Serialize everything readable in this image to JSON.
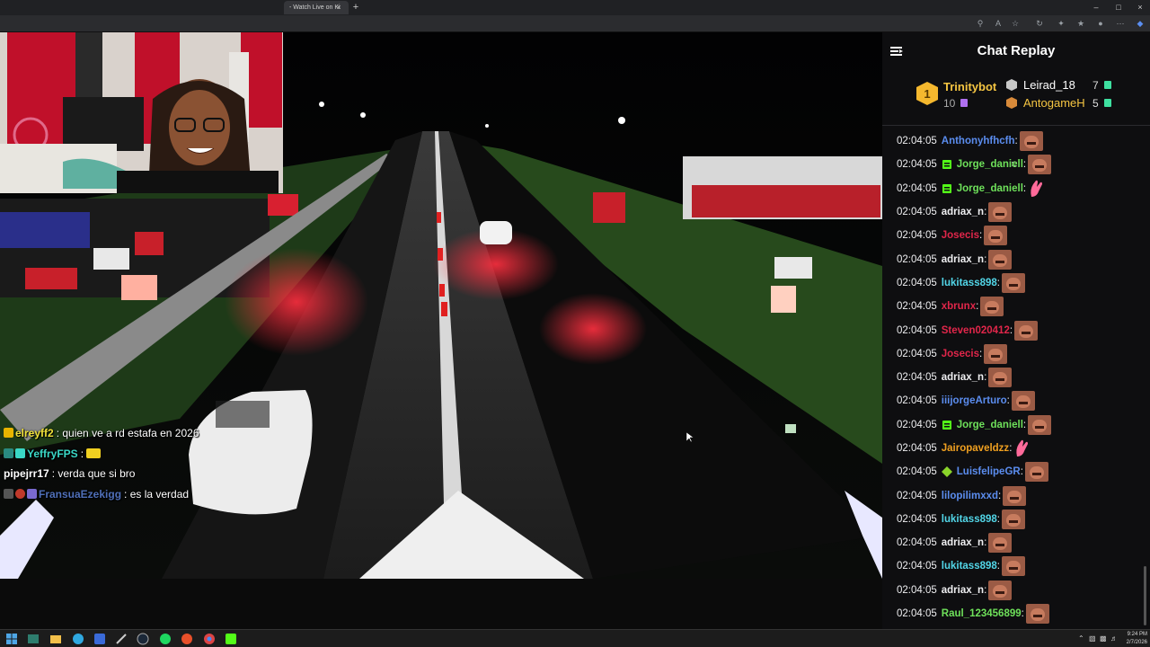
{
  "browser": {
    "tab_title": "- Watch Live on Ki",
    "tab_close": "×",
    "new_tab": "+"
  },
  "overlay_chat": [
    {
      "user": "elreyff2",
      "message": ": quien ve a rd estafa en 2026",
      "color": "#f0e23a",
      "badge_color": "#e8b400"
    },
    {
      "user": "YeffryFPS",
      "message": ":",
      "color": "#3ad7c6",
      "badge_color": "#3ad7c6"
    },
    {
      "user": "pipejrr17",
      "message": ": verda que si bro",
      "color": "#ffffff",
      "badge_color": ""
    },
    {
      "user": "FransuaEzekigg",
      "message": ": es la verdad",
      "color": "#4f6fb8",
      "badge_color": "#c0392b"
    }
  ],
  "chat": {
    "title": "Chat Replay",
    "leaderboard": {
      "first": {
        "rank": "1",
        "name": "Trinitybot",
        "count": "10",
        "color": "#f5c542"
      },
      "second": {
        "rank": "2",
        "name": "Leirad_18",
        "count": "7",
        "color": "#ffffff"
      },
      "third": {
        "rank": "3",
        "name": "AntogameH",
        "count": "5",
        "color": "#f5c542"
      }
    },
    "messages": [
      {
        "time": "02:04:05",
        "user": "Anthonyhfhcfh",
        "color": "#5b8def",
        "badge": "",
        "emote": "face"
      },
      {
        "time": "02:04:05",
        "user": "Jorge_daniell",
        "color": "#6ee05a",
        "badge": "green",
        "emote": "face"
      },
      {
        "time": "02:04:05",
        "user": "Jorge_daniell",
        "color": "#6ee05a",
        "badge": "green",
        "emote": "hand"
      },
      {
        "time": "02:04:05",
        "user": "adriax_n",
        "color": "#efeff1",
        "badge": "",
        "emote": "face"
      },
      {
        "time": "02:04:05",
        "user": "Josecis",
        "color": "#e0264a",
        "badge": "",
        "emote": "face"
      },
      {
        "time": "02:04:05",
        "user": "adriax_n",
        "color": "#efeff1",
        "badge": "",
        "emote": "face"
      },
      {
        "time": "02:04:05",
        "user": "lukitass898",
        "color": "#52d6e8",
        "badge": "",
        "emote": "face"
      },
      {
        "time": "02:04:05",
        "user": "xbrunx",
        "color": "#e0264a",
        "badge": "",
        "emote": "face"
      },
      {
        "time": "02:04:05",
        "user": "Steven020412",
        "color": "#e0264a",
        "badge": "",
        "emote": "face"
      },
      {
        "time": "02:04:05",
        "user": "Josecis",
        "color": "#e0264a",
        "badge": "",
        "emote": "face"
      },
      {
        "time": "02:04:05",
        "user": "adriax_n",
        "color": "#efeff1",
        "badge": "",
        "emote": "face"
      },
      {
        "time": "02:04:05",
        "user": "iiijorgeArturo",
        "color": "#5b8def",
        "badge": "",
        "emote": "face"
      },
      {
        "time": "02:04:05",
        "user": "Jorge_daniell",
        "color": "#6ee05a",
        "badge": "green",
        "emote": "face"
      },
      {
        "time": "02:04:05",
        "user": "Jairopaveldzz",
        "color": "#f0a020",
        "badge": "",
        "emote": "hand"
      },
      {
        "time": "02:04:05",
        "user": "LuisfelipeGR",
        "color": "#5b8def",
        "badge": "diamond",
        "emote": "face"
      },
      {
        "time": "02:04:05",
        "user": "lilopilimxxd",
        "color": "#5b8def",
        "badge": "",
        "emote": "face"
      },
      {
        "time": "02:04:05",
        "user": "lukitass898",
        "color": "#52d6e8",
        "badge": "",
        "emote": "face"
      },
      {
        "time": "02:04:05",
        "user": "adriax_n",
        "color": "#efeff1",
        "badge": "",
        "emote": "face"
      },
      {
        "time": "02:04:05",
        "user": "lukitass898",
        "color": "#52d6e8",
        "badge": "",
        "emote": "face"
      },
      {
        "time": "02:04:05",
        "user": "adriax_n",
        "color": "#efeff1",
        "badge": "",
        "emote": "face"
      },
      {
        "time": "02:04:05",
        "user": "Raul_123456899",
        "color": "#6ee05a",
        "badge": "",
        "emote": "face"
      }
    ]
  },
  "taskbar": {
    "clock_time": "9:24 PM",
    "clock_date": "2/7/2026"
  },
  "colors": {
    "chat_bg": "#0e0e10",
    "accent_green": "#53fc18"
  }
}
